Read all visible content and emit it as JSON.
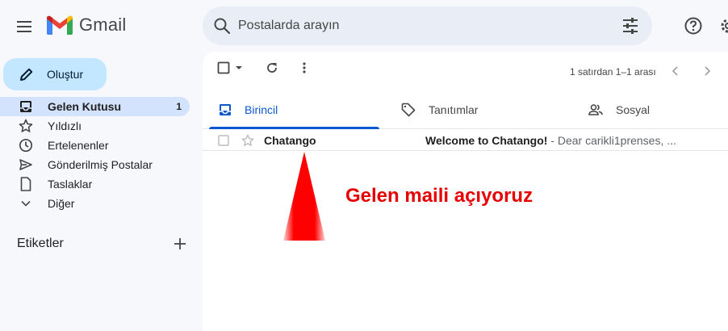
{
  "header": {
    "logo_text": "Gmail",
    "search_placeholder": "Postalarda arayın"
  },
  "compose": {
    "label": "Oluştur"
  },
  "sidebar": {
    "items": [
      {
        "label": "Gelen Kutusu",
        "count": "1",
        "icon": "inbox-icon",
        "active": true
      },
      {
        "label": "Yıldızlı",
        "icon": "star-icon"
      },
      {
        "label": "Ertelenenler",
        "icon": "clock-icon"
      },
      {
        "label": "Gönderilmiş Postalar",
        "icon": "send-icon"
      },
      {
        "label": "Taslaklar",
        "icon": "draft-icon"
      },
      {
        "label": "Diğer",
        "icon": "chevron-down-icon"
      }
    ],
    "labels_title": "Etiketler"
  },
  "toolbar": {
    "paging": "1 satırdan 1–1 arası"
  },
  "tabs": [
    {
      "label": "Birincil",
      "icon": "inbox-icon",
      "active": true
    },
    {
      "label": "Tanıtımlar",
      "icon": "tag-icon"
    },
    {
      "label": "Sosyal",
      "icon": "people-icon"
    }
  ],
  "emails": [
    {
      "sender": "Chatango",
      "subject": "Welcome to Chatango!",
      "snippet": " - Dear carikli1prenses, ..."
    }
  ],
  "annotation": {
    "text": "Gelen maili açıyoruz"
  },
  "colors": {
    "accent": "#0b57d0",
    "compose_bg": "#c2e7ff",
    "active_nav": "#d3e3fd",
    "annotation": "#e60000"
  }
}
